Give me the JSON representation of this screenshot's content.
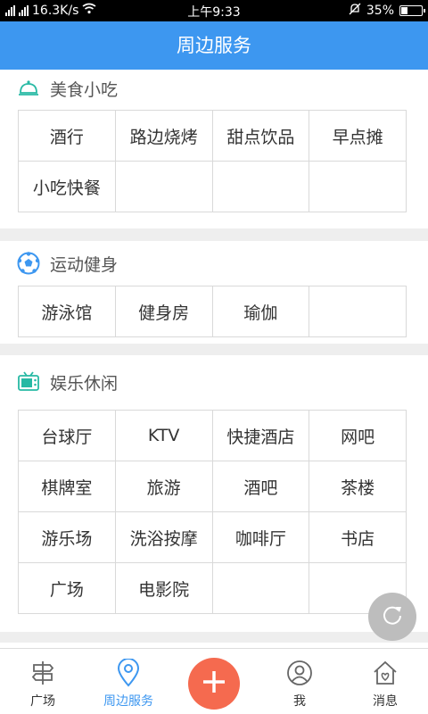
{
  "status_bar": {
    "net_speed": "16.3K/s",
    "time": "上午9:33",
    "battery": "35%",
    "battery_level": 0.35,
    "signal_label": "4G",
    "signal2_label": "2G"
  },
  "header": {
    "title": "周边服务"
  },
  "sections": [
    {
      "title": "美食小吃",
      "icon": "cloche-icon",
      "items": [
        "酒行",
        "路边烧烤",
        "甜点饮品",
        "早点摊",
        "小吃快餐",
        "",
        "",
        ""
      ]
    },
    {
      "title": "运动健身",
      "icon": "soccer-ball-icon",
      "items": [
        "游泳馆",
        "健身房",
        "瑜伽",
        ""
      ]
    },
    {
      "title": "娱乐休闲",
      "icon": "tv-icon",
      "items": [
        "台球厅",
        "KTV",
        "快捷酒店",
        "网吧",
        "棋牌室",
        "旅游",
        "酒吧",
        "茶楼",
        "游乐场",
        "洗浴按摩",
        "咖啡厅",
        "书店",
        "广场",
        "电影院",
        "",
        ""
      ]
    }
  ],
  "tabs": [
    {
      "label": "广场",
      "icon": "signpost-icon"
    },
    {
      "label": "周边服务",
      "icon": "location-pin-icon",
      "active": true
    },
    {
      "label": "",
      "icon": "add-icon"
    },
    {
      "label": "我",
      "icon": "user-icon"
    },
    {
      "label": "消息",
      "icon": "home-heart-icon"
    }
  ],
  "colors": {
    "brand": "#3d97f0",
    "add_button": "#f56a4f",
    "float_button": "#bdbdbd",
    "teal_icon": "#27b9a4"
  }
}
